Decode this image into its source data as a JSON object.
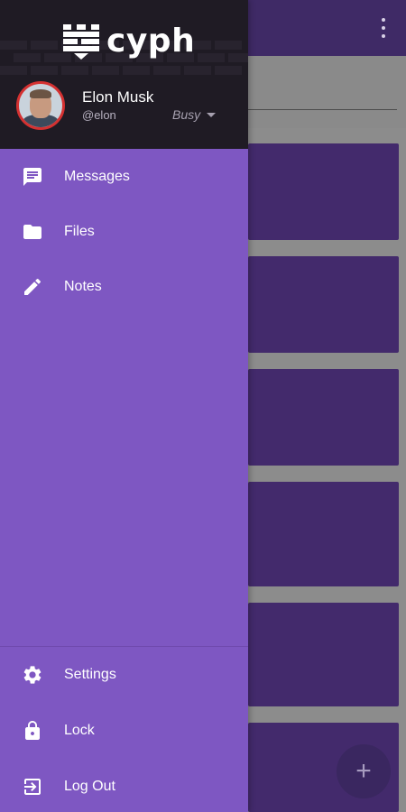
{
  "app": {
    "brand": "cyph",
    "user": {
      "name": "Elon Musk",
      "handle": "@elon",
      "status": "Busy"
    }
  },
  "drawer": {
    "primary_items": [
      {
        "label": "Messages",
        "icon": "message-icon"
      },
      {
        "label": "Files",
        "icon": "folder-icon"
      },
      {
        "label": "Notes",
        "icon": "pencil-icon"
      }
    ],
    "secondary_items": [
      {
        "label": "Settings",
        "icon": "gear-icon"
      },
      {
        "label": "Lock",
        "icon": "lock-icon"
      },
      {
        "label": "Log Out",
        "icon": "logout-icon"
      }
    ]
  },
  "fab": {
    "symbol": "+"
  },
  "colors": {
    "drawer": "#7e57c2",
    "header": "#1f1b24",
    "toolbar": "#3f2a66",
    "card": "#432a6c",
    "avatar_ring": "#d43131"
  }
}
